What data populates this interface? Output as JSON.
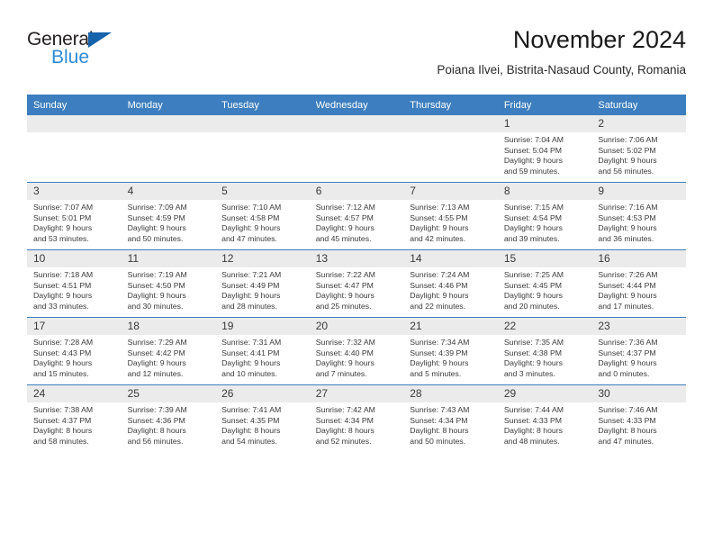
{
  "brand": {
    "word_primary": "General",
    "word_secondary": "Blue",
    "triangle_icon": "triangle-icon",
    "primary_color": "#231f20",
    "secondary_color": "#2e8bd6",
    "triangle_color": "#1763ab"
  },
  "header": {
    "title": "November 2024",
    "subtitle": "Poiana Ilvei, Bistrita-Nasaud County, Romania",
    "accent_color": "#3c7ebf",
    "daynum_band_color": "#ebebeb"
  },
  "calendar": {
    "month": "November",
    "year": "2024",
    "weekday_headers": [
      "Sunday",
      "Monday",
      "Tuesday",
      "Wednesday",
      "Thursday",
      "Friday",
      "Saturday"
    ],
    "weeks": [
      [
        {
          "day": "",
          "blank": true,
          "info": ""
        },
        {
          "day": "",
          "blank": true,
          "info": ""
        },
        {
          "day": "",
          "blank": true,
          "info": ""
        },
        {
          "day": "",
          "blank": true,
          "info": ""
        },
        {
          "day": "",
          "blank": true,
          "info": ""
        },
        {
          "day": "1",
          "blank": false,
          "info": "Sunrise: 7:04 AM\nSunset: 5:04 PM\nDaylight: 9 hours\nand 59 minutes."
        },
        {
          "day": "2",
          "blank": false,
          "info": "Sunrise: 7:06 AM\nSunset: 5:02 PM\nDaylight: 9 hours\nand 56 minutes."
        }
      ],
      [
        {
          "day": "3",
          "blank": false,
          "info": "Sunrise: 7:07 AM\nSunset: 5:01 PM\nDaylight: 9 hours\nand 53 minutes."
        },
        {
          "day": "4",
          "blank": false,
          "info": "Sunrise: 7:09 AM\nSunset: 4:59 PM\nDaylight: 9 hours\nand 50 minutes."
        },
        {
          "day": "5",
          "blank": false,
          "info": "Sunrise: 7:10 AM\nSunset: 4:58 PM\nDaylight: 9 hours\nand 47 minutes."
        },
        {
          "day": "6",
          "blank": false,
          "info": "Sunrise: 7:12 AM\nSunset: 4:57 PM\nDaylight: 9 hours\nand 45 minutes."
        },
        {
          "day": "7",
          "blank": false,
          "info": "Sunrise: 7:13 AM\nSunset: 4:55 PM\nDaylight: 9 hours\nand 42 minutes."
        },
        {
          "day": "8",
          "blank": false,
          "info": "Sunrise: 7:15 AM\nSunset: 4:54 PM\nDaylight: 9 hours\nand 39 minutes."
        },
        {
          "day": "9",
          "blank": false,
          "info": "Sunrise: 7:16 AM\nSunset: 4:53 PM\nDaylight: 9 hours\nand 36 minutes."
        }
      ],
      [
        {
          "day": "10",
          "blank": false,
          "info": "Sunrise: 7:18 AM\nSunset: 4:51 PM\nDaylight: 9 hours\nand 33 minutes."
        },
        {
          "day": "11",
          "blank": false,
          "info": "Sunrise: 7:19 AM\nSunset: 4:50 PM\nDaylight: 9 hours\nand 30 minutes."
        },
        {
          "day": "12",
          "blank": false,
          "info": "Sunrise: 7:21 AM\nSunset: 4:49 PM\nDaylight: 9 hours\nand 28 minutes."
        },
        {
          "day": "13",
          "blank": false,
          "info": "Sunrise: 7:22 AM\nSunset: 4:47 PM\nDaylight: 9 hours\nand 25 minutes."
        },
        {
          "day": "14",
          "blank": false,
          "info": "Sunrise: 7:24 AM\nSunset: 4:46 PM\nDaylight: 9 hours\nand 22 minutes."
        },
        {
          "day": "15",
          "blank": false,
          "info": "Sunrise: 7:25 AM\nSunset: 4:45 PM\nDaylight: 9 hours\nand 20 minutes."
        },
        {
          "day": "16",
          "blank": false,
          "info": "Sunrise: 7:26 AM\nSunset: 4:44 PM\nDaylight: 9 hours\nand 17 minutes."
        }
      ],
      [
        {
          "day": "17",
          "blank": false,
          "info": "Sunrise: 7:28 AM\nSunset: 4:43 PM\nDaylight: 9 hours\nand 15 minutes."
        },
        {
          "day": "18",
          "blank": false,
          "info": "Sunrise: 7:29 AM\nSunset: 4:42 PM\nDaylight: 9 hours\nand 12 minutes."
        },
        {
          "day": "19",
          "blank": false,
          "info": "Sunrise: 7:31 AM\nSunset: 4:41 PM\nDaylight: 9 hours\nand 10 minutes."
        },
        {
          "day": "20",
          "blank": false,
          "info": "Sunrise: 7:32 AM\nSunset: 4:40 PM\nDaylight: 9 hours\nand 7 minutes."
        },
        {
          "day": "21",
          "blank": false,
          "info": "Sunrise: 7:34 AM\nSunset: 4:39 PM\nDaylight: 9 hours\nand 5 minutes."
        },
        {
          "day": "22",
          "blank": false,
          "info": "Sunrise: 7:35 AM\nSunset: 4:38 PM\nDaylight: 9 hours\nand 3 minutes."
        },
        {
          "day": "23",
          "blank": false,
          "info": "Sunrise: 7:36 AM\nSunset: 4:37 PM\nDaylight: 9 hours\nand 0 minutes."
        }
      ],
      [
        {
          "day": "24",
          "blank": false,
          "info": "Sunrise: 7:38 AM\nSunset: 4:37 PM\nDaylight: 8 hours\nand 58 minutes."
        },
        {
          "day": "25",
          "blank": false,
          "info": "Sunrise: 7:39 AM\nSunset: 4:36 PM\nDaylight: 8 hours\nand 56 minutes."
        },
        {
          "day": "26",
          "blank": false,
          "info": "Sunrise: 7:41 AM\nSunset: 4:35 PM\nDaylight: 8 hours\nand 54 minutes."
        },
        {
          "day": "27",
          "blank": false,
          "info": "Sunrise: 7:42 AM\nSunset: 4:34 PM\nDaylight: 8 hours\nand 52 minutes."
        },
        {
          "day": "28",
          "blank": false,
          "info": "Sunrise: 7:43 AM\nSunset: 4:34 PM\nDaylight: 8 hours\nand 50 minutes."
        },
        {
          "day": "29",
          "blank": false,
          "info": "Sunrise: 7:44 AM\nSunset: 4:33 PM\nDaylight: 8 hours\nand 48 minutes."
        },
        {
          "day": "30",
          "blank": false,
          "info": "Sunrise: 7:46 AM\nSunset: 4:33 PM\nDaylight: 8 hours\nand 47 minutes."
        }
      ]
    ]
  }
}
